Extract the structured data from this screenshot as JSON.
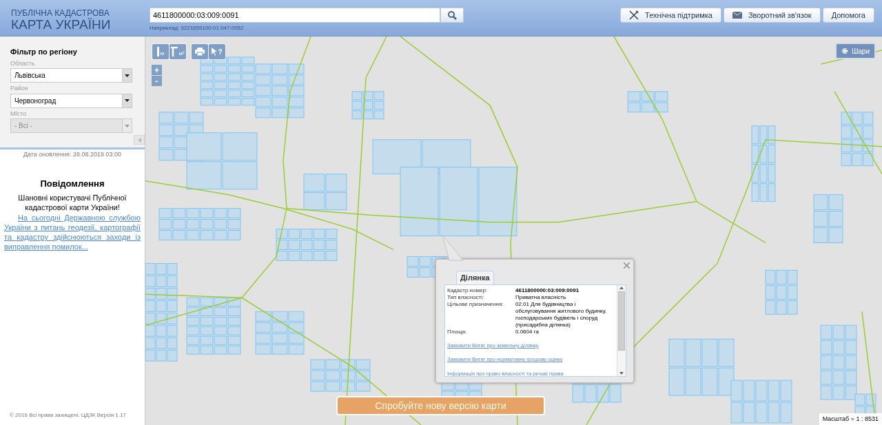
{
  "header": {
    "logo_top": "ПУБЛІЧНА КАДАСТРОВА",
    "logo_bottom": "КАРТА УКРАЇНИ",
    "search": {
      "value": "4611800000:03:009:0091"
    },
    "search_example": "Наприклад: 3221655100:01:047:0052",
    "buttons": [
      {
        "kind": "support",
        "label": "Технічна підтримка"
      },
      {
        "kind": "feedback",
        "label": "Зворотний зв'язок"
      },
      {
        "kind": "help",
        "label": "Допомога"
      }
    ]
  },
  "sidebar": {
    "filter_title": "Фільтр по регіону",
    "fields": [
      {
        "label": "Область",
        "value": "Львівська",
        "disabled": false
      },
      {
        "label": "Район",
        "value": "Червоноград",
        "disabled": false
      },
      {
        "label": "Місто",
        "value": "- Всі -",
        "disabled": true
      }
    ],
    "update_date": "Дата оновлення: 28.08.2019 03:00",
    "notice_title": "Повідомлення",
    "notice_greeting": "Шановні користувачі Публічної кадастрової карти України!",
    "notice_link": "На сьогодні Державною службою України з питань геодезії, картографії та кадастру здійснюються заходи із виправлення помилок...",
    "footer": "© 2016 Всі права захищені. ЦДЗК Версія 1.17"
  },
  "map": {
    "tools": [
      {
        "kind": "distance",
        "label": "м"
      },
      {
        "kind": "area",
        "label": "м²"
      },
      {
        "kind": "print"
      },
      {
        "kind": "identify",
        "label": "?"
      }
    ],
    "zoom": [
      "+",
      "-"
    ],
    "layers_button": "Шари",
    "popup": {
      "tab": "Ділянка",
      "rows": [
        {
          "label": "Кадастр.номер:",
          "value": "4611800000:03:009:0091",
          "bold": true
        },
        {
          "label": "Тип власності:",
          "value": "Приватна власність",
          "bold": false
        },
        {
          "label": "Цільове призначення:",
          "value": "02.01 Для будівництва і обслуговування житлового будинку, господарських будівель і споруд (присадибна ділянка)",
          "bold": false
        },
        {
          "label": "Площа:",
          "value": "0.0604 га",
          "bold": false
        }
      ],
      "links": [
        "Замовити Витяг про земельну ділянку",
        "Замовити Витяг про нормативну грошову оцінку",
        "Інформація про право власності та речові права"
      ]
    },
    "new_version_button": "Спробуйте нову версію карти",
    "scale": "Масштаб = 1 : 8531"
  }
}
